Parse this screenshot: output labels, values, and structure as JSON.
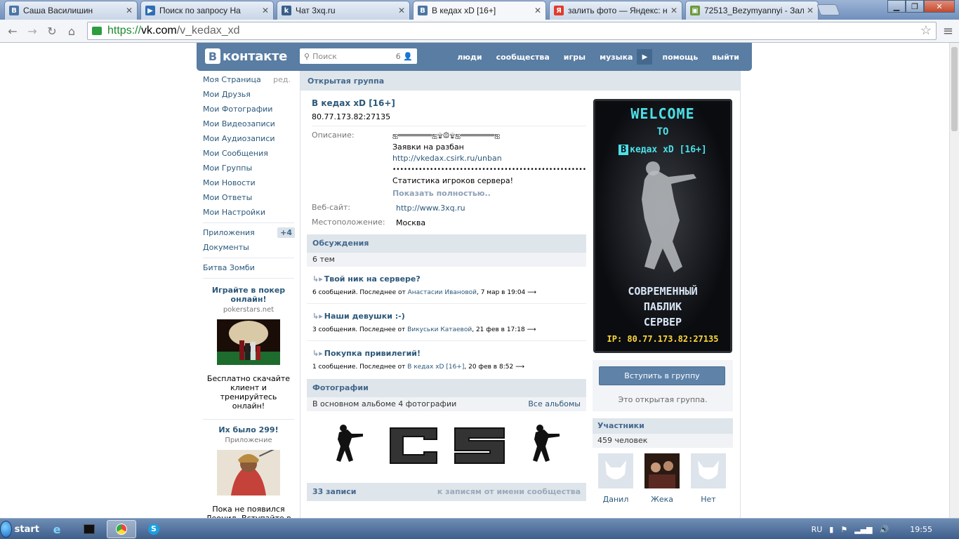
{
  "browser": {
    "tabs": [
      {
        "title": "Саша Василишин",
        "favicon": "vk-icon",
        "color": "#4c75a3"
      },
      {
        "title": "Поиск по запросу На",
        "favicon": "video-icon",
        "color": "#2f6eb5"
      },
      {
        "title": "Чат 3xq.ru",
        "favicon": "cs-icon",
        "color": "#3a5e8a"
      },
      {
        "title": "В кедах xD [16+]",
        "favicon": "vk-icon",
        "color": "#4c75a3"
      },
      {
        "title": "залить фото — Яндекс: н",
        "favicon": "yandex-icon",
        "color": "#e03c2d"
      },
      {
        "title": "72513_Bezymyannyi - Зал",
        "favicon": "image-icon",
        "color": "#6a9a3c"
      }
    ],
    "url_scheme": "https://",
    "url_host": "vk.com",
    "url_path": "/v_kedax_xd"
  },
  "vk": {
    "logo_text": "контакте",
    "logo_letter": "В",
    "search_placeholder": "Поиск",
    "search_count": "6",
    "nav": [
      "люди",
      "сообщества",
      "игры",
      "музыка",
      "помощь",
      "выйти"
    ]
  },
  "sidebar": {
    "items": [
      {
        "label": "Моя Страница",
        "extra": "ред."
      },
      {
        "label": "Мои Друзья"
      },
      {
        "label": "Мои Фотографии"
      },
      {
        "label": "Мои Видеозаписи"
      },
      {
        "label": "Мои Аудиозаписи"
      },
      {
        "label": "Мои Сообщения"
      },
      {
        "label": "Мои Группы"
      },
      {
        "label": "Мои Новости"
      },
      {
        "label": "Мои Ответы"
      },
      {
        "label": "Мои Настройки"
      }
    ],
    "apps_label": "Приложения",
    "apps_badge": "+4",
    "docs_label": "Документы",
    "game_label": "Битва Зомби",
    "ad1": {
      "title": "Играйте в покер онлайн!",
      "domain": "pokerstars.net",
      "text": "Бесплатно скачайте клиент и тренируйтесь онлайн!"
    },
    "ad2": {
      "title": "Их было 299!",
      "sub": "Приложение",
      "text": "Пока не появился Леонид. Вступайте в"
    }
  },
  "group": {
    "type_label": "Открытая группа",
    "name": "В кедах xD [16+]",
    "status": "80.77.173.82:27135",
    "desc_label": "Описание:",
    "desc_line1": "ஐ════════ஐ۩۞۩ஐ════════ஐ",
    "desc_line2": "Заявки на разбан",
    "desc_link": "http://vkedax.csirk.ru/unban",
    "desc_line3": "••••••••••••••••••••••••••••••••••••••••••••••••••••",
    "desc_line4": "Статистика игроков сервера!",
    "show_more": "Показать полностью..",
    "site_label": "Веб-сайт:",
    "site_value": "http://www.3xq.ru",
    "loc_label": "Местоположение:",
    "loc_value": "Москва"
  },
  "discussions": {
    "header": "Обсуждения",
    "count": "6 тем",
    "topics": [
      {
        "title": "Твой ник на сервере?",
        "meta_prefix": "6 сообщений. Последнее от",
        "author": "Анастасии Ивановой",
        "date": ", 7 мар в 19:04"
      },
      {
        "title": "Наши девушки :-)",
        "meta_prefix": "3 сообщения. Последнее от",
        "author": "Викуськи Катаевой",
        "date": ", 21 фев в 17:18"
      },
      {
        "title": "Покупка привилегий!",
        "meta_prefix": "1 сообщение. Последнее от",
        "author": "В кедах xD [16+]",
        "date": ", 20 фев в 8:52"
      }
    ]
  },
  "photos": {
    "header": "Фотографии",
    "subtitle": "В основном альбоме 4 фотографии",
    "all_link": "Все альбомы"
  },
  "wall": {
    "header": "33 записи",
    "right_link": "к записям от имени сообщества"
  },
  "avatar": {
    "line1": "WELCOME",
    "line2": "TO",
    "line3": "кедах xD [16+]",
    "line4": "СОВРЕМЕННЫЙ",
    "line5": "ПАБЛИК",
    "line6": "СЕРВЕР",
    "line7": "IP: 80.77.173.82:27135"
  },
  "join": {
    "button": "Вступить в группу",
    "note": "Это открытая группа."
  },
  "members": {
    "header": "Участники",
    "count": "459 человек",
    "list": [
      {
        "name": "Данил"
      },
      {
        "name": "Жека"
      },
      {
        "name": "Нет"
      }
    ]
  },
  "taskbar": {
    "start": "start",
    "lang": "RU",
    "time": "19:55"
  }
}
